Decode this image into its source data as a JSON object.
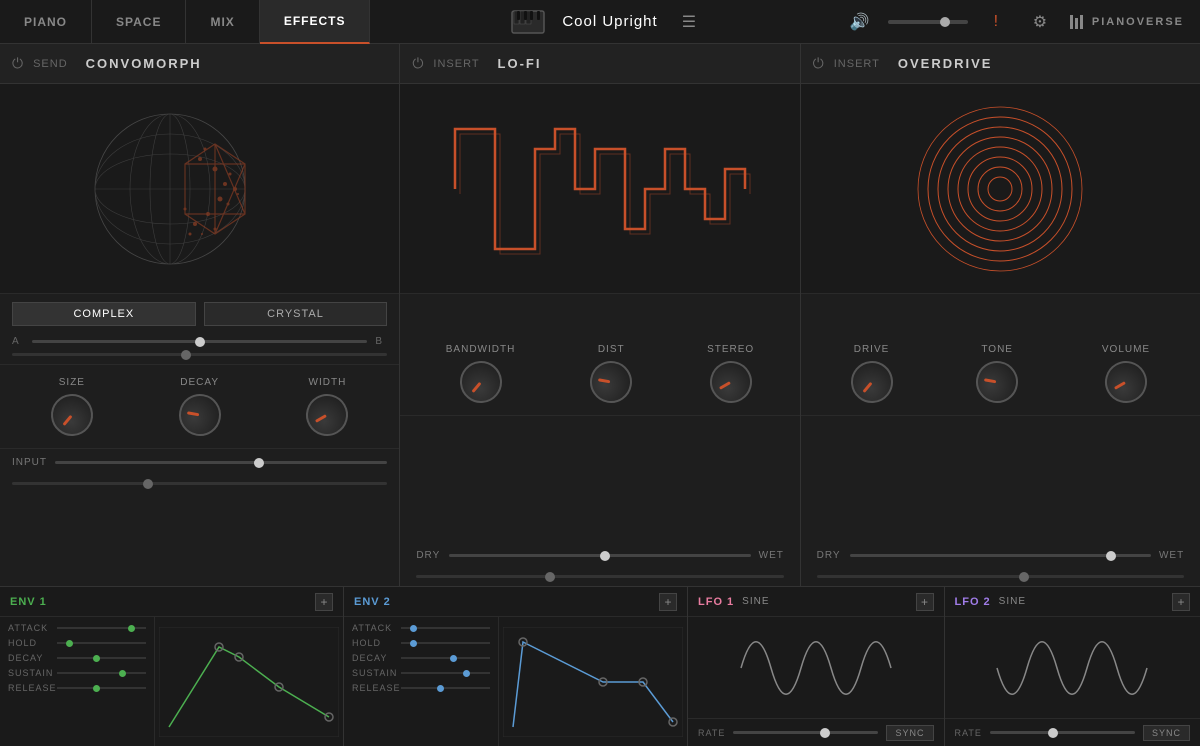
{
  "header": {
    "tabs": [
      {
        "label": "PIANO",
        "active": false
      },
      {
        "label": "SPACE",
        "active": false
      },
      {
        "label": "MIX",
        "active": false
      },
      {
        "label": "EFFECTS",
        "active": true
      }
    ],
    "preset_name": "Cool Upright",
    "hamburger_label": "☰",
    "volume_icon": "🔊",
    "exclamation": "!",
    "gear": "⚙",
    "pianoverse": "PIANOVERSE"
  },
  "panels": {
    "convomorph": {
      "type_label": "SEND",
      "name": "CONVOMORPH",
      "preset_a": "COMPLEX",
      "preset_b": "CRYSTAL",
      "ab_label_a": "A",
      "ab_label_b": "B",
      "knobs": [
        {
          "label": "SIZE",
          "pos": "pos-7"
        },
        {
          "label": "DECAY",
          "pos": "pos-5"
        },
        {
          "label": "WIDTH",
          "pos": "pos-6"
        }
      ],
      "input_label": "INPUT",
      "input_thumb": "60%"
    },
    "lofi": {
      "type_label": "INSERT",
      "name": "LO-FI",
      "knobs": [
        {
          "label": "BANDWIDTH",
          "pos": "pos-7"
        },
        {
          "label": "DIST",
          "pos": "pos-5"
        },
        {
          "label": "STEREO",
          "pos": "pos-6"
        }
      ],
      "dry_label": "DRY",
      "wet_label": "WET",
      "dry_thumb": "50%"
    },
    "overdrive": {
      "type_label": "INSERT",
      "name": "OVERDRIVE",
      "knobs": [
        {
          "label": "DRIVE",
          "pos": "pos-7"
        },
        {
          "label": "TONE",
          "pos": "pos-5"
        },
        {
          "label": "VOLUME",
          "pos": "pos-6"
        }
      ],
      "dry_label": "DRY",
      "wet_label": "WET",
      "dry_thumb": "85%"
    }
  },
  "bottom": {
    "env1": {
      "title": "ENV 1",
      "color": "green",
      "type": "SINE",
      "params": [
        {
          "label": "ATTACK",
          "pos": "at-right"
        },
        {
          "label": "HOLD",
          "pos": "at-start"
        },
        {
          "label": "DECAY",
          "pos": "at-mid"
        },
        {
          "label": "SUSTAIN",
          "pos": "at-75"
        },
        {
          "label": "RELEASE",
          "pos": "at-mid"
        }
      ]
    },
    "env2": {
      "title": "ENV 2",
      "color": "blue",
      "type": "SINE",
      "params": [
        {
          "label": "ATTACK",
          "pos": "at-start"
        },
        {
          "label": "HOLD",
          "pos": "at-start"
        },
        {
          "label": "DECAY",
          "pos": "at-60"
        },
        {
          "label": "SUSTAIN",
          "pos": "at-75"
        },
        {
          "label": "RELEASE",
          "pos": "at-mid"
        }
      ]
    },
    "lfo1": {
      "title": "LFO 1",
      "color": "pink",
      "type": "SINE",
      "rate_label": "RATE",
      "sync_label": "SYNC"
    },
    "lfo2": {
      "title": "LFO 2",
      "color": "purple",
      "type": "SINE",
      "rate_label": "RATE",
      "sync_label": "SYNC"
    }
  }
}
